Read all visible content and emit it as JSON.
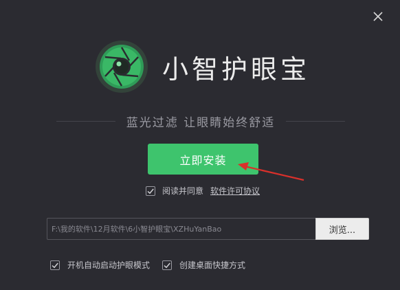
{
  "window": {
    "close_icon": "close-icon"
  },
  "brand": {
    "logo_icon": "eye-lens-logo",
    "title": "小智护眼宝"
  },
  "tagline": "蓝光过滤  让眼睛始终舒适",
  "install_button": {
    "label": "立即安装"
  },
  "annotation": {
    "arrow_color": "#d9302b"
  },
  "agreement": {
    "checked": true,
    "label": "阅读并同意",
    "link_text": "软件许可协议"
  },
  "install_path": {
    "value": "F:\\我的软件\\12月软件\\6小智护眼宝\\XZHuYanBao",
    "browse_label": "浏览..."
  },
  "options": [
    {
      "checked": true,
      "label": "开机自动启动护眼模式"
    },
    {
      "checked": true,
      "label": "创建桌面快捷方式"
    }
  ],
  "colors": {
    "background": "#2b2b31",
    "accent": "#3ec46d",
    "text": "#ececec",
    "muted": "#9a9aa2"
  }
}
